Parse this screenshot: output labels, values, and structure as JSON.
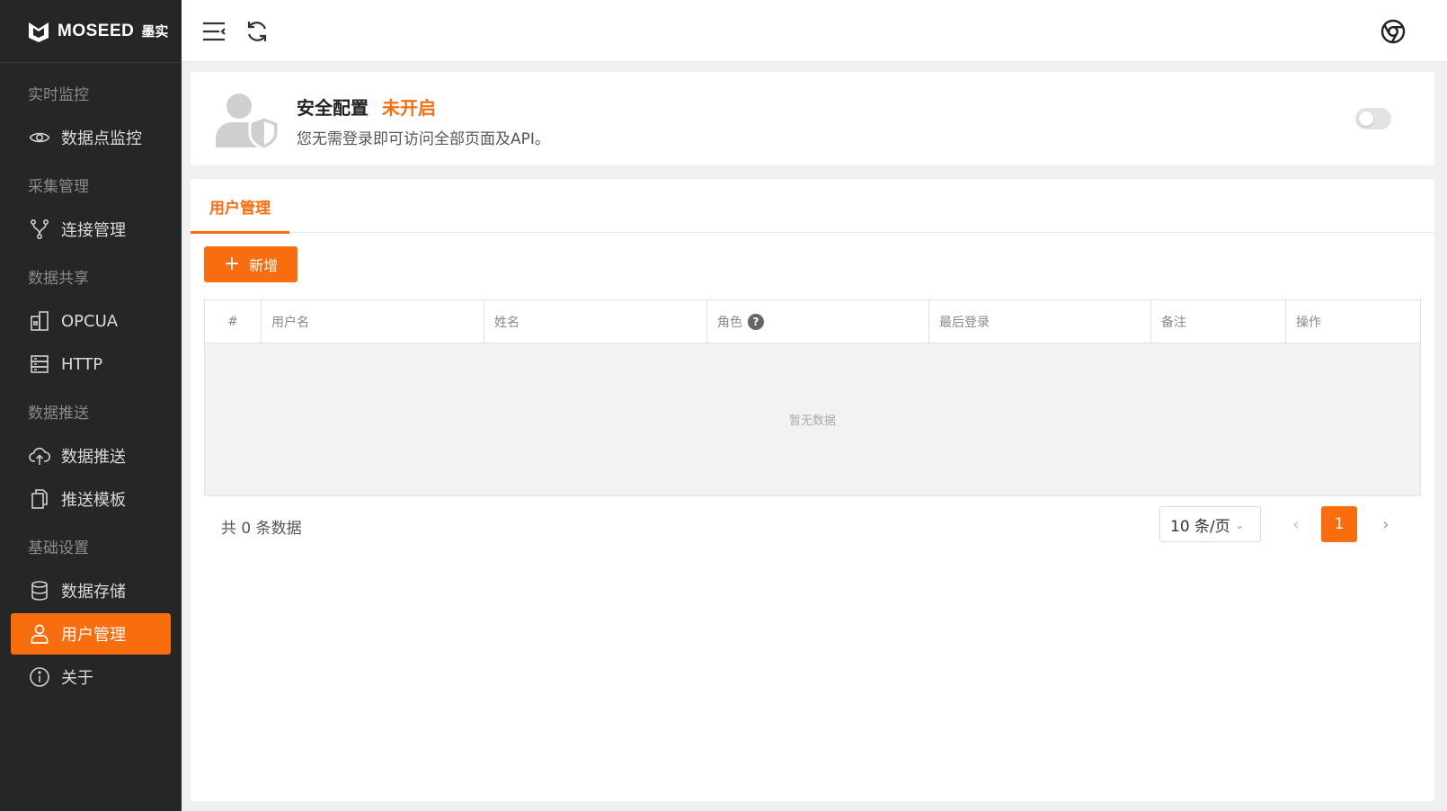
{
  "logo": {
    "brand": "MOSEED",
    "brand_cn": "墨实"
  },
  "sidebar": {
    "groups": [
      {
        "label": "实时监控",
        "items": [
          {
            "label": "数据点监控",
            "icon": "eye-icon"
          }
        ]
      },
      {
        "label": "采集管理",
        "items": [
          {
            "label": "连接管理",
            "icon": "branch-icon"
          }
        ]
      },
      {
        "label": "数据共享",
        "items": [
          {
            "label": "OPCUA",
            "icon": "building-icon"
          },
          {
            "label": "HTTP",
            "icon": "server-icon"
          }
        ]
      },
      {
        "label": "数据推送",
        "items": [
          {
            "label": "数据推送",
            "icon": "cloud-upload-icon"
          },
          {
            "label": "推送模板",
            "icon": "copy-icon"
          }
        ]
      },
      {
        "label": "基础设置",
        "items": [
          {
            "label": "数据存储",
            "icon": "database-icon"
          },
          {
            "label": "用户管理",
            "icon": "user-icon",
            "active": true
          },
          {
            "label": "关于",
            "icon": "info-icon"
          }
        ]
      }
    ]
  },
  "header": {
    "menu_icon": "menu-fold-icon",
    "refresh_icon": "refresh-icon",
    "browser_icon": "chrome-icon"
  },
  "security": {
    "title": "安全配置",
    "status": "未开启",
    "description": "您无需登录即可访问全部页面及API。",
    "enabled": false
  },
  "tabs": [
    {
      "label": "用户管理",
      "active": true
    }
  ],
  "toolbar": {
    "add_label": "新增"
  },
  "table": {
    "columns": [
      "#",
      "用户名",
      "姓名",
      "角色",
      "最后登录",
      "备注",
      "操作"
    ],
    "empty_text": "暂无数据"
  },
  "pagination": {
    "total_text": "共 0 条数据",
    "page_size": "10 条/页",
    "current_page": "1"
  },
  "colors": {
    "accent": "#fa6d0f",
    "sidebar_bg": "#262626"
  }
}
